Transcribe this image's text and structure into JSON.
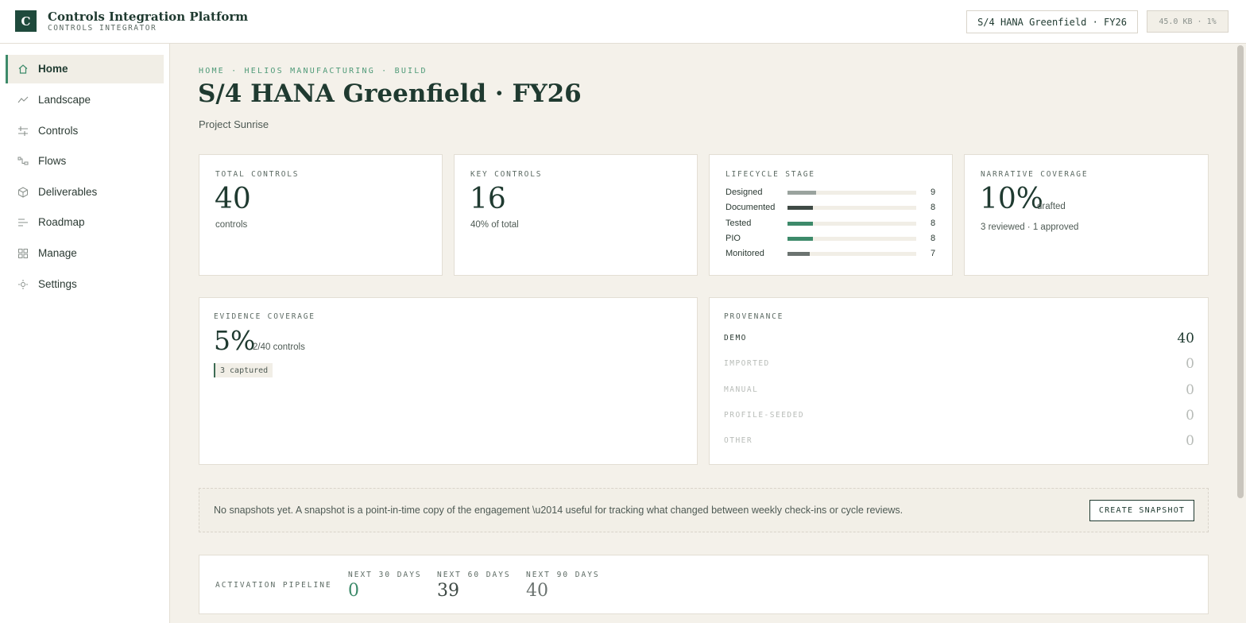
{
  "header": {
    "logo_letter": "C",
    "app_title": "Controls Integration Platform",
    "app_subtitle": "CONTROLS INTEGRATOR",
    "project_pill": "S/4 HANA Greenfield · FY26",
    "size_pill": "45.0 KB · 1%"
  },
  "sidebar": {
    "items": [
      {
        "label": "Home",
        "icon": "home-icon",
        "active": true
      },
      {
        "label": "Landscape",
        "icon": "trend-icon",
        "active": false
      },
      {
        "label": "Controls",
        "icon": "sliders-icon",
        "active": false
      },
      {
        "label": "Flows",
        "icon": "flow-icon",
        "active": false
      },
      {
        "label": "Deliverables",
        "icon": "package-icon",
        "active": false
      },
      {
        "label": "Roadmap",
        "icon": "roadmap-icon",
        "active": false
      },
      {
        "label": "Manage",
        "icon": "grid-icon",
        "active": false
      },
      {
        "label": "Settings",
        "icon": "settings-icon",
        "active": false
      }
    ]
  },
  "main": {
    "breadcrumb": "HOME · HELIOS MANUFACTURING · BUILD",
    "title": "S/4 HANA Greenfield · FY26",
    "subtitle": "Project Sunrise"
  },
  "cards": {
    "total_controls": {
      "label": "TOTAL CONTROLS",
      "value": "40",
      "note": "controls"
    },
    "key_controls": {
      "label": "KEY CONTROLS",
      "value": "16",
      "note": "40% of total"
    },
    "lifecycle": {
      "label": "LIFECYCLE STAGE",
      "max": 40,
      "stages": [
        {
          "name": "Designed",
          "count": 9,
          "color": "#9aa39e"
        },
        {
          "name": "Documented",
          "count": 8,
          "color": "#3f4a45"
        },
        {
          "name": "Tested",
          "count": 8,
          "color": "#3d8a6a"
        },
        {
          "name": "PIO",
          "count": 8,
          "color": "#3d8a6a"
        },
        {
          "name": "Monitored",
          "count": 7,
          "color": "#6b7370"
        }
      ]
    },
    "narrative": {
      "label": "NARRATIVE COVERAGE",
      "value": "10%",
      "suffix": "drafted",
      "note": "3 reviewed · 1 approved"
    },
    "evidence": {
      "label": "EVIDENCE COVERAGE",
      "value": "5%",
      "suffix": "2/40 controls",
      "tag": "3 captured"
    },
    "provenance": {
      "label": "PROVENANCE",
      "rows": [
        {
          "label": "DEMO",
          "value": "40",
          "active": true
        },
        {
          "label": "IMPORTED",
          "value": "0",
          "active": false
        },
        {
          "label": "MANUAL",
          "value": "0",
          "active": false
        },
        {
          "label": "PROFILE-SEEDED",
          "value": "0",
          "active": false
        },
        {
          "label": "OTHER",
          "value": "0",
          "active": false
        }
      ]
    }
  },
  "snapshot": {
    "text": "No snapshots yet. A snapshot is a point-in-time copy of the engagement \\u2014 useful for tracking what changed between weekly check-ins or cycle reviews.",
    "button": "CREATE SNAPSHOT"
  },
  "pipeline": {
    "label": "ACTIVATION PIPELINE",
    "buckets": [
      {
        "label": "NEXT 30 DAYS",
        "value": "0",
        "color": "#3d8a6a"
      },
      {
        "label": "NEXT 60 DAYS",
        "value": "39",
        "color": "#3f4a45"
      },
      {
        "label": "NEXT 90 DAYS",
        "value": "40",
        "color": "#6b7370"
      }
    ]
  },
  "colors": {
    "accent": "#3d8a6a",
    "brand": "#1f4a3c",
    "background": "#f4f1ea"
  }
}
